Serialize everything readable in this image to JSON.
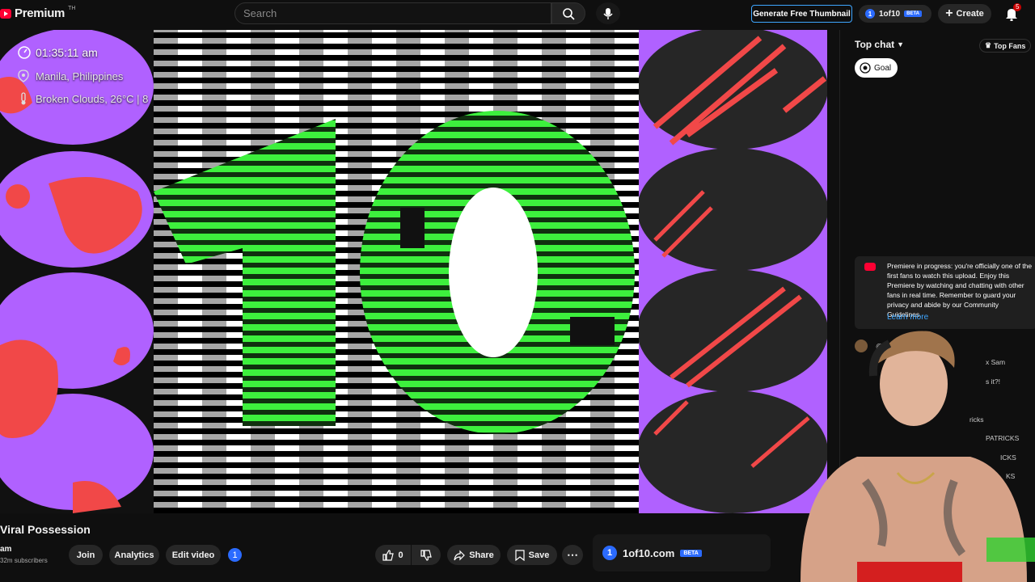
{
  "header": {
    "logo_text": "Premium",
    "logo_tm": "TH",
    "search_placeholder": "Search",
    "generate_thumbnail": "Generate Free Thumbnail",
    "oneof10_label": "1of10",
    "oneof10_badge": "1",
    "beta": "BETA",
    "create": "Create",
    "notification_count": "5"
  },
  "overlay": {
    "time": "01:35:11 am",
    "location": "Manila, Philippines",
    "weather": "Broken Clouds, 26°C | 8",
    "weather_suffix": "…"
  },
  "chat": {
    "top_chat": "Top chat",
    "top_fans": "Top Fans",
    "goal": "Goal",
    "premiere_text": "Premiere in progress: you're officially one of the first fans to watch this upload. Enjoy this Premiere by watching and chatting with other fans in real time. Remember to guard your privacy and abide by our Community Guidelines.",
    "learn_more": "Learn more",
    "messages": [
      {
        "text": "@Regiwo…"
      },
      {
        "text": "x Sam"
      },
      {
        "text": "s it?!"
      },
      {
        "text": ""
      },
      {
        "text": "ricks"
      },
      {
        "text": "PATRICKS"
      },
      {
        "text": "ICKS"
      },
      {
        "text": "KS"
      }
    ]
  },
  "video": {
    "title": "Viral Possession",
    "channel": "am",
    "subscribers": "32m subscribers",
    "buttons": {
      "join": "Join",
      "analytics": "Analytics",
      "edit": "Edit video",
      "like_count": "0",
      "share": "Share",
      "save": "Save"
    },
    "promo": {
      "name": "1of10.com",
      "badge": "BETA",
      "icon_label": "1"
    }
  },
  "colors": {
    "accent_blue": "#3ea6ff",
    "brand_red": "#ff0033",
    "green": "#3df03d",
    "purple": "#b061ff",
    "coral": "#f14848"
  }
}
